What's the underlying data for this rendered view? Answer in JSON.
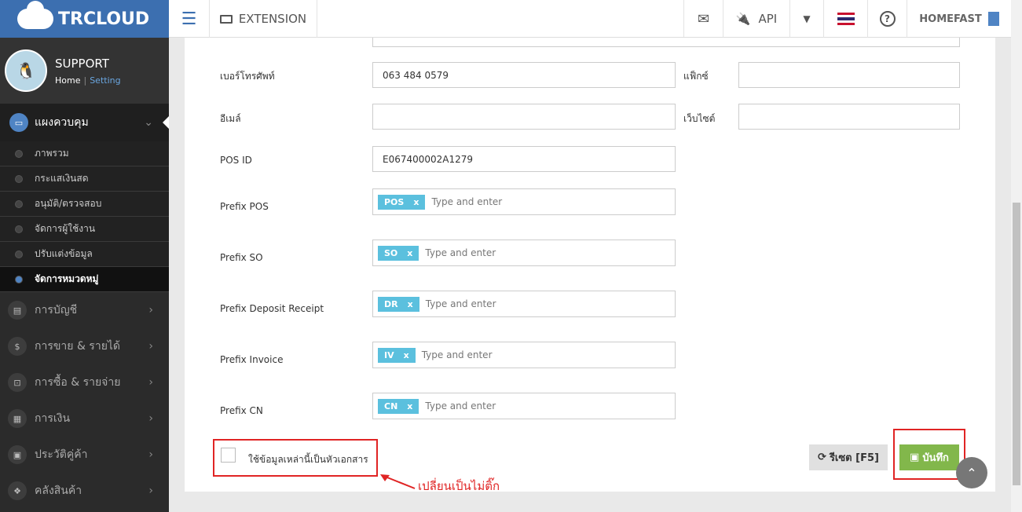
{
  "brand": {
    "name": "TRCLOUD"
  },
  "profile": {
    "name": "SUPPORT",
    "home": "Home",
    "sep": "|",
    "setting": "Setting"
  },
  "menu": {
    "main": "แผงควบคุม",
    "sub": [
      "ภาพรวม",
      "กระแสเงินสด",
      "อนุมัติ/ตรวจสอบ",
      "จัดการผู้ใช้งาน",
      "ปรับแต่งข้อมูล",
      "จัดการหมวดหมู่"
    ],
    "cats": [
      "การบัญชี",
      "การขาย & รายได้",
      "การซื้อ & รายจ่าย",
      "การเงิน",
      "ประวัติคู่ค้า",
      "คลังสินค้า"
    ]
  },
  "topbar": {
    "extension": "EXTENSION",
    "api": "API",
    "company": "HOMEFAST"
  },
  "form": {
    "phone_label": "เบอร์โทรศัพท์",
    "phone_value": "063 484 0579",
    "fax_label": "แฟ็กซ์",
    "email_label": "อีเมล์",
    "website_label": "เว็บไซต์",
    "posid_label": "POS ID",
    "posid_value": "E067400002A1279",
    "prefix": [
      {
        "label": "Prefix POS",
        "tag": "POS"
      },
      {
        "label": "Prefix SO",
        "tag": "SO"
      },
      {
        "label": "Prefix Deposit Receipt",
        "tag": "DR"
      },
      {
        "label": "Prefix Invoice",
        "tag": "IV"
      },
      {
        "label": "Prefix CN",
        "tag": "CN"
      }
    ],
    "tag_remove": "x",
    "placeholder": "Type and enter",
    "checkbox_label": "ใช้ข้อมูลเหล่านี้เป็นหัวเอกสาร",
    "reset_label": "รีเซต [F5]",
    "save_label": "บันทึก"
  },
  "annotation": "เปลี่ยนเป็นไม่ติ๊ก"
}
